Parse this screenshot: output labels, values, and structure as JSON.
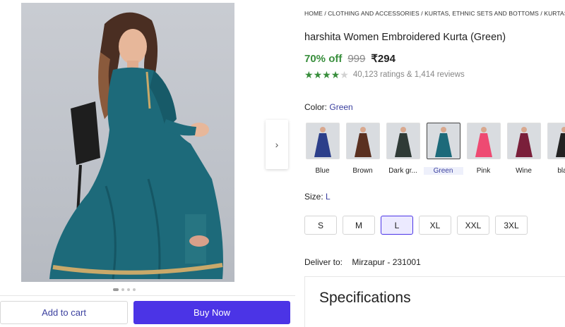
{
  "gallery": {
    "next_icon": "chevron-right-icon",
    "dots": [
      true,
      false,
      false,
      false
    ]
  },
  "actions": {
    "add_to_cart": "Add to cart",
    "buy_now": "Buy Now"
  },
  "breadcrumb": "HOME / CLOTHING AND ACCESSORIES / KURTAS, ETHNIC SETS AND BOTTOMS / KURTAS / W",
  "product": {
    "title": "harshita Women Embroidered Kurta (Green)",
    "discount": "70% off",
    "mrp": "999",
    "price": "₹294",
    "rating_stars": 4,
    "rating_text": "40,123 ratings  & 1,414 reviews"
  },
  "color": {
    "label": "Color:",
    "selected": "Green",
    "options": [
      {
        "name": "Blue",
        "hex": "#2c3f8a",
        "selected": false
      },
      {
        "name": "Brown",
        "hex": "#5a3020",
        "selected": false
      },
      {
        "name": "Dark gr...",
        "hex": "#2f3a36",
        "selected": false
      },
      {
        "name": "Green",
        "hex": "#1d6a7a",
        "selected": true
      },
      {
        "name": "Pink",
        "hex": "#ee4a72",
        "selected": false
      },
      {
        "name": "Wine",
        "hex": "#7a1f3a",
        "selected": false
      },
      {
        "name": "blac",
        "hex": "#222222",
        "selected": false
      }
    ]
  },
  "size": {
    "label": "Size:",
    "selected": "L",
    "options": [
      "S",
      "M",
      "L",
      "XL",
      "XXL",
      "3XL"
    ]
  },
  "delivery": {
    "label": "Deliver to:",
    "location": "Mirzapur - 231001"
  },
  "specifications": {
    "title": "Specifications"
  },
  "colors": {
    "accent": "#4b34e6",
    "link": "#3a3f9e",
    "discount": "#388e3c",
    "dress": "#1d6a7a"
  }
}
